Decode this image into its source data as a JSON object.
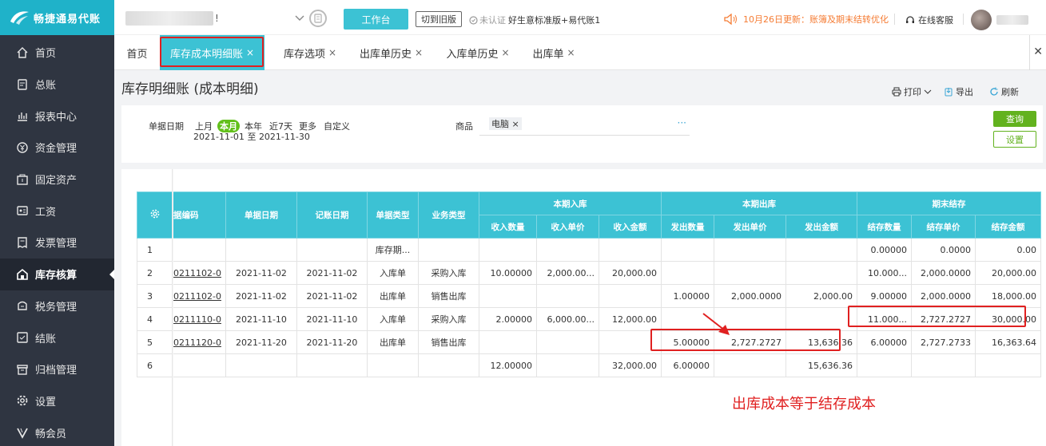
{
  "brand": {
    "name": "畅捷通易代账",
    "accent": "#3cc2d4",
    "sidebar_bg": "#2f3541"
  },
  "sidebar": {
    "items": [
      {
        "label": "首页",
        "icon": "home-icon"
      },
      {
        "label": "总账",
        "icon": "ledger-icon"
      },
      {
        "label": "报表中心",
        "icon": "chart-icon"
      },
      {
        "label": "资金管理",
        "icon": "money-icon"
      },
      {
        "label": "固定资产",
        "icon": "asset-icon"
      },
      {
        "label": "工资",
        "icon": "salary-icon"
      },
      {
        "label": "发票管理",
        "icon": "invoice-icon"
      },
      {
        "label": "库存核算",
        "icon": "warehouse-icon",
        "active": true
      },
      {
        "label": "税务管理",
        "icon": "tax-icon"
      },
      {
        "label": "结账",
        "icon": "close-book-icon"
      },
      {
        "label": "归档管理",
        "icon": "archive-icon"
      },
      {
        "label": "设置",
        "icon": "gear-icon"
      },
      {
        "label": "畅会员",
        "icon": "vip-icon"
      }
    ]
  },
  "topbar": {
    "account_suffix": "!",
    "workbench": "工作台",
    "switch_old": "切到旧版",
    "unverified": "未认证",
    "edition": "好生意标准版+易代账1",
    "notice": "10月26日更新：账簿及期末结转优化",
    "service": "在线客服"
  },
  "tabs": [
    {
      "label": "首页",
      "closable": false
    },
    {
      "label": "库存成本明细账",
      "closable": true,
      "active": true
    },
    {
      "label": "库存选项",
      "closable": true
    },
    {
      "label": "出库单历史",
      "closable": true
    },
    {
      "label": "入库单历史",
      "closable": true
    },
    {
      "label": "出库单",
      "closable": true
    }
  ],
  "page": {
    "title": "库存明细账 (成本明细)",
    "tools": {
      "print": "打印",
      "export": "导出",
      "refresh": "刷新"
    }
  },
  "filters": {
    "date_label": "单据日期",
    "quick": [
      "上月",
      "本月",
      "本年",
      "近7天",
      "更多",
      "自定义"
    ],
    "quick_active": "本月",
    "date_start": "2021-11-01",
    "date_sep": "至",
    "date_end": "2021-11-30",
    "goods_label": "商品",
    "goods_chip": "电脑",
    "more": "···",
    "query": "查询",
    "settings": "设置"
  },
  "table": {
    "group_headers": {
      "in": "本期入库",
      "out": "本期出库",
      "end": "期末结存"
    },
    "headers": {
      "doc_no": "据编码",
      "doc_date": "单据日期",
      "post_date": "记账日期",
      "doc_type": "单据类型",
      "biz_type": "业务类型",
      "in_qty": "收入数量",
      "in_price": "收入单价",
      "in_amt": "收入金额",
      "out_qty": "发出数量",
      "out_price": "发出单价",
      "out_amt": "发出金额",
      "end_qty": "结存数量",
      "end_price": "结存单价",
      "end_amt": "结存金额"
    },
    "rows": [
      [
        "1",
        "",
        "",
        "",
        "库存期...",
        "",
        "",
        "",
        "",
        "",
        "",
        "",
        "0.00000",
        "0.0000",
        "0.00"
      ],
      [
        "2",
        "0211102-0",
        "2021-11-02",
        "2021-11-02",
        "入库单",
        "采购入库",
        "10.00000",
        "2,000.00...",
        "20,000.00",
        "",
        "",
        "",
        "10.000...",
        "2,000.0000",
        "20,000.00"
      ],
      [
        "3",
        "0211102-0",
        "2021-11-02",
        "2021-11-02",
        "出库单",
        "销售出库",
        "",
        "",
        "",
        "1.00000",
        "2,000.0000",
        "2,000.00",
        "9.00000",
        "2,000.0000",
        "18,000.00"
      ],
      [
        "4",
        "0211110-0",
        "2021-11-10",
        "2021-11-10",
        "入库单",
        "采购入库",
        "2.00000",
        "6,000.00...",
        "12,000.00",
        "",
        "",
        "",
        "11.000...",
        "2,727.2727",
        "30,000.00"
      ],
      [
        "5",
        "0211120-0",
        "2021-11-20",
        "2021-11-20",
        "出库单",
        "销售出库",
        "",
        "",
        "",
        "5.00000",
        "2,727.2727",
        "13,636.36",
        "6.00000",
        "2,727.2733",
        "16,363.64"
      ],
      [
        "6",
        "",
        "",
        "",
        "",
        "",
        "12.00000",
        "",
        "32,000.00",
        "6.00000",
        "",
        "15,636.36",
        "",
        "",
        ""
      ]
    ]
  },
  "annotation": {
    "text": "出库成本等于结存成本",
    "color": "#e02020"
  }
}
